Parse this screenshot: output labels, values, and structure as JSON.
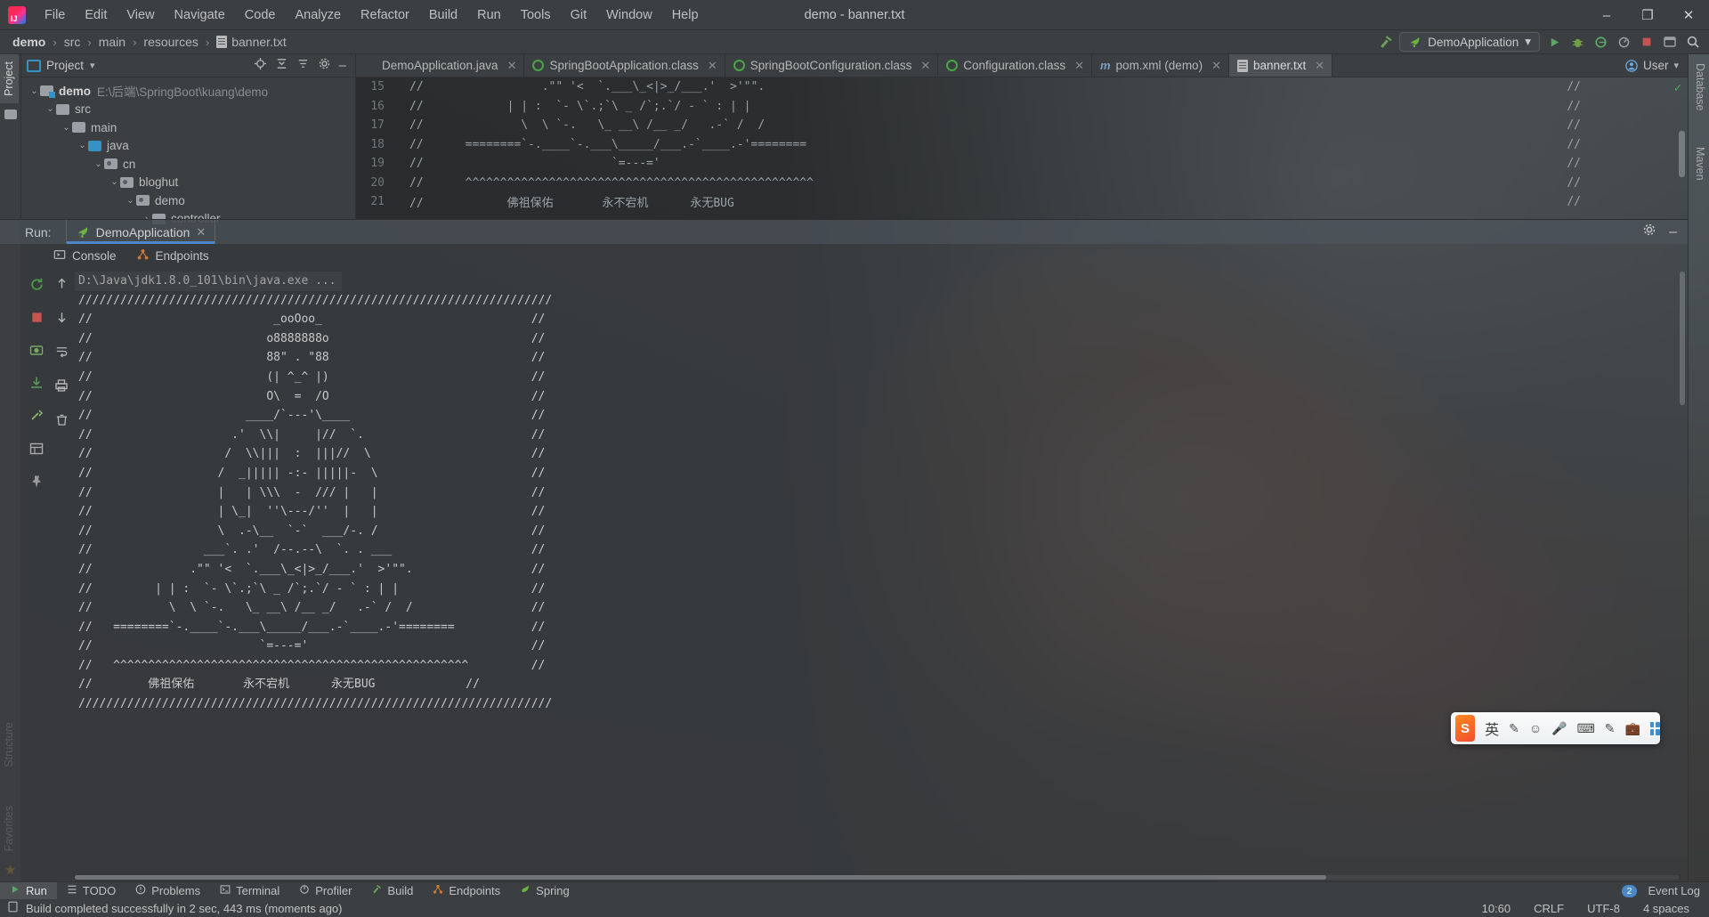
{
  "window": {
    "title": "demo - banner.txt",
    "controls": {
      "minimize": "–",
      "maximize": "❐",
      "close": "✕"
    }
  },
  "menubar": {
    "items": [
      "File",
      "Edit",
      "View",
      "Navigate",
      "Code",
      "Analyze",
      "Refactor",
      "Build",
      "Run",
      "Tools",
      "Git",
      "Window",
      "Help"
    ]
  },
  "breadcrumb": {
    "items": [
      "demo",
      "src",
      "main",
      "resources",
      "banner.txt"
    ],
    "separator": "›"
  },
  "navbar_right": {
    "run_configuration": "DemoApplication",
    "dropdown_caret": "▾",
    "icons": [
      "build-hammer-icon",
      "run-icon",
      "debug-icon",
      "run-with-coverage-icon",
      "profiler-icon",
      "stop-icon",
      "search-everywhere-icon",
      "settings-icon"
    ]
  },
  "left_strips": {
    "top": "Project",
    "bottom_items": [
      "Structure",
      "Favorites"
    ]
  },
  "right_strips": {
    "items": [
      "Database",
      "Maven"
    ]
  },
  "project_panel": {
    "title": "Project",
    "caret": "▾",
    "tree": [
      {
        "depth": 0,
        "arrow": "⌄",
        "icon": "module-folder-icon",
        "name": "demo",
        "bold": true,
        "path": "E:\\后端\\SpringBoot\\kuang\\demo"
      },
      {
        "depth": 1,
        "arrow": "⌄",
        "icon": "folder-icon",
        "name": "src",
        "bold": false,
        "path": ""
      },
      {
        "depth": 2,
        "arrow": "⌄",
        "icon": "folder-icon",
        "name": "main",
        "bold": false,
        "path": ""
      },
      {
        "depth": 3,
        "arrow": "⌄",
        "icon": "source-folder-icon",
        "name": "java",
        "bold": false,
        "path": ""
      },
      {
        "depth": 4,
        "arrow": "⌄",
        "icon": "package-icon",
        "name": "cn",
        "bold": false,
        "path": ""
      },
      {
        "depth": 5,
        "arrow": "⌄",
        "icon": "package-icon",
        "name": "bloghut",
        "bold": false,
        "path": ""
      },
      {
        "depth": 6,
        "arrow": "⌄",
        "icon": "package-icon",
        "name": "demo",
        "bold": false,
        "path": ""
      },
      {
        "depth": 7,
        "arrow": "›",
        "icon": "folder-icon",
        "name": "controller",
        "bold": false,
        "path": ""
      }
    ]
  },
  "editor": {
    "tabs": [
      {
        "label": "DemoApplication.java",
        "icon": "java-class-icon",
        "active": false,
        "closable": true
      },
      {
        "label": "SpringBootApplication.class",
        "icon": "annotation-icon",
        "active": false,
        "closable": true
      },
      {
        "label": "SpringBootConfiguration.class",
        "icon": "annotation-icon",
        "active": false,
        "closable": true
      },
      {
        "label": "Configuration.class",
        "icon": "annotation-icon",
        "active": false,
        "closable": true
      },
      {
        "label": "pom.xml (demo)",
        "icon": "maven-icon",
        "active": false,
        "closable": true
      },
      {
        "label": "banner.txt",
        "icon": "text-file-icon",
        "active": true,
        "closable": true
      }
    ],
    "user_chip": "User",
    "lines": [
      {
        "no": "15",
        "text": "//                 .\"\" '<  `.___\\_<|>_/___.'  >'\"\".",
        "tail": "//"
      },
      {
        "no": "16",
        "text": "//            | | :  `- \\`.;`\\ _ /`;.`/ - ` : | |",
        "tail": "//"
      },
      {
        "no": "17",
        "text": "//              \\  \\ `-.   \\_ __\\ /__ _/   .-` /  /",
        "tail": "//"
      },
      {
        "no": "18",
        "text": "//      ========`-.____`-.___\\_____/___.-`____.-'========",
        "tail": "//"
      },
      {
        "no": "19",
        "text": "//                           `=---='",
        "tail": "//"
      },
      {
        "no": "20",
        "text": "//      ^^^^^^^^^^^^^^^^^^^^^^^^^^^^^^^^^^^^^^^^^^^^^^^^^^",
        "tail": "//"
      },
      {
        "no": "21",
        "text": "//            佛祖保佑       永不宕机      永无BUG",
        "tail": "//"
      }
    ]
  },
  "run_window": {
    "label": "Run:",
    "tab": "DemoApplication",
    "close": "✕",
    "subtabs": [
      {
        "label": "Console",
        "icon": "console-icon"
      },
      {
        "label": "Endpoints",
        "icon": "endpoints-icon"
      }
    ],
    "side_icons": [
      "rerun-icon",
      "scroll-up-icon",
      "scroll-down-icon",
      "stop-icon",
      "soft-wrap-icon",
      "camera-icon",
      "print-icon",
      "clear-all-icon",
      "export-icon",
      "grid-icon",
      "pin-icon",
      "trash-icon"
    ],
    "header_icons": [
      "settings-icon",
      "hide-icon"
    ],
    "console_lines": [
      "D:\\Java\\jdk1.8.0_101\\bin\\java.exe ...",
      "////////////////////////////////////////////////////////////////////",
      "//                          _ooOoo_                              //",
      "//                         o8888888o                             //",
      "//                         88\" . \"88                             //",
      "//                         (| ^_^ |)                             //",
      "//                         O\\  =  /O                             //",
      "//                      ____/`---'\\____                          //",
      "//                    .'  \\\\|     |//  `.                        //",
      "//                   /  \\\\|||  :  |||//  \\                       //",
      "//                  /  _||||| -:- |||||-  \\                      //",
      "//                  |   | \\\\\\  -  /// |   |                      //",
      "//                  | \\_|  ''\\---/''  |   |                      //",
      "//                  \\  .-\\__  `-`  ___/-. /                      //",
      "//                ___`. .'  /--.--\\  `. . ___                    //",
      "//              .\"\" '<  `.___\\_<|>_/___.'  >'\"\".                 //",
      "//         | | :  `- \\`.;`\\ _ /`;.`/ - ` : | |                   //",
      "//           \\  \\ `-.   \\_ __\\ /__ _/   .-` /  /                 //",
      "//   ========`-.____`-.___\\_____/___.-`____.-'========           //",
      "//                        `=---='                                //",
      "//   ^^^^^^^^^^^^^^^^^^^^^^^^^^^^^^^^^^^^^^^^^^^^^^^^^^^         //",
      "//        佛祖保佑       永不宕机      永无BUG             //",
      "////////////////////////////////////////////////////////////////////"
    ]
  },
  "bottom_bar": {
    "items": [
      {
        "label": "Run",
        "icon": "run-icon",
        "active": true
      },
      {
        "label": "TODO",
        "icon": "todo-icon",
        "active": false
      },
      {
        "label": "Problems",
        "icon": "problems-icon",
        "active": false
      },
      {
        "label": "Terminal",
        "icon": "terminal-icon",
        "active": false
      },
      {
        "label": "Profiler",
        "icon": "profiler-icon",
        "active": false
      },
      {
        "label": "Build",
        "icon": "build-icon",
        "active": false
      },
      {
        "label": "Endpoints",
        "icon": "endpoints-icon",
        "active": false
      },
      {
        "label": "Spring",
        "icon": "spring-icon",
        "active": false
      }
    ],
    "event_log": {
      "label": "Event Log",
      "count": "2"
    }
  },
  "status_bar": {
    "message": "Build completed successfully in 2 sec, 443 ms (moments ago)",
    "caret_position": "10:60",
    "line_separator": "CRLF",
    "encoding": "UTF-8",
    "indent": "4 spaces"
  },
  "ime_toolbar": {
    "logo": "S",
    "mode": "英",
    "icons": [
      "pen-icon",
      "emoji-icon",
      "microphone-icon",
      "keyboard-icon",
      "translate-icon",
      "toolbox-icon",
      "apps-grid-icon"
    ]
  },
  "colors": {
    "accent": "#4a88c7",
    "success": "#4caf50",
    "panel_bg": "#3c3f41",
    "editor_bg": "#2b2b2b",
    "ime_orange": "#f24b2f"
  }
}
